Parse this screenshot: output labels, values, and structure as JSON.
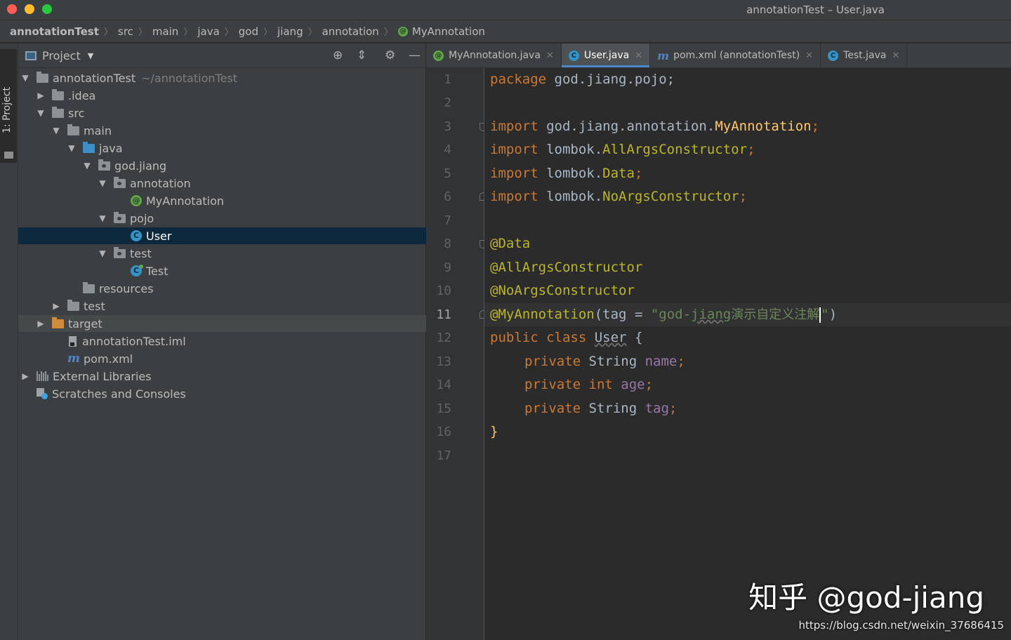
{
  "window": {
    "title": "annotationTest – User.java"
  },
  "breadcrumbs": [
    "annotationTest",
    "src",
    "main",
    "java",
    "god",
    "jiang",
    "annotation",
    "MyAnnotation"
  ],
  "toolstrip": {
    "project_tab": "1: Project"
  },
  "project_panel": {
    "title": "Project",
    "tree": [
      {
        "label": "annotationTest",
        "note": "~/annotationTest",
        "icon": "module-folder-icon"
      },
      {
        "label": ".idea",
        "icon": "folder-icon"
      },
      {
        "label": "src",
        "icon": "folder-icon"
      },
      {
        "label": "main",
        "icon": "folder-icon"
      },
      {
        "label": "java",
        "icon": "source-folder-icon"
      },
      {
        "label": "god.jiang",
        "icon": "package-icon"
      },
      {
        "label": "annotation",
        "icon": "package-icon"
      },
      {
        "label": "MyAnnotation",
        "icon": "annotation-icon"
      },
      {
        "label": "pojo",
        "icon": "package-icon"
      },
      {
        "label": "User",
        "icon": "class-icon"
      },
      {
        "label": "test",
        "icon": "package-icon"
      },
      {
        "label": "Test",
        "icon": "class-icon"
      },
      {
        "label": "resources",
        "icon": "resources-folder-icon"
      },
      {
        "label": "test",
        "icon": "folder-icon"
      },
      {
        "label": "target",
        "icon": "excluded-folder-icon"
      },
      {
        "label": "annotationTest.iml",
        "icon": "iml-file-icon"
      },
      {
        "label": "pom.xml",
        "icon": "maven-icon"
      },
      {
        "label": "External Libraries",
        "icon": "library-icon"
      },
      {
        "label": "Scratches and Consoles",
        "icon": "scratch-icon"
      }
    ]
  },
  "tabs": [
    {
      "label": "MyAnnotation.java",
      "icon": "annotation-icon",
      "active": false
    },
    {
      "label": "User.java",
      "icon": "class-icon",
      "active": true
    },
    {
      "label": "pom.xml (annotationTest)",
      "icon": "maven-icon",
      "active": false
    },
    {
      "label": "Test.java",
      "icon": "class-icon",
      "active": false
    }
  ],
  "editor": {
    "line_numbers": [
      "1",
      "2",
      "3",
      "4",
      "5",
      "6",
      "7",
      "8",
      "9",
      "10",
      "11",
      "12",
      "13",
      "14",
      "15",
      "16",
      "17"
    ],
    "current_line": "11",
    "code": {
      "l1_kw": "package",
      "l1_rest": " god.jiang.pojo;",
      "l3_kw": "import",
      "l3_pkg": " god.jiang.annotation.",
      "l3_cls": "MyAnnotation",
      "l4_kw": "import",
      "l4_pkg": " lombok.",
      "l4_cls": "AllArgsConstructor",
      "l5_kw": "import",
      "l5_pkg": " lombok.",
      "l5_cls": "Data",
      "l6_kw": "import",
      "l6_pkg": " lombok.",
      "l6_cls": "NoArgsConstructor",
      "l8": "@Data",
      "l9": "@AllArgsConstructor",
      "l10": "@NoArgsConstructor",
      "l11_ann": "@MyAnnotation",
      "l11_open": "(",
      "l11_param": "tag",
      "l11_eq": " = ",
      "l11_str1": "\"god-",
      "l11_str2": "jiang",
      "l11_str3": "演示自定义注解",
      "l11_str4": "\"",
      "l11_close": ")",
      "l12_kw": "public class",
      "l12_cls": "User",
      "l12_brace": " {",
      "l13_kw": "private",
      "l13_type": " String ",
      "l13_field": "name",
      "l14_kw": "private int",
      "l14_field": "age",
      "l15_kw": "private",
      "l15_type": " String ",
      "l15_field": "tag",
      "semicolon": ";",
      "l16": "}"
    }
  },
  "watermark": {
    "text": "知乎 @god-jiang",
    "url": "https://blog.csdn.net/weixin_37686415"
  },
  "colors": {
    "keyword": "#cc7832",
    "annotation": "#bbb529",
    "string": "#6a8759",
    "field": "#9876aa",
    "selection": "#0d293e",
    "tab_active_underline": "#4a88c7"
  }
}
